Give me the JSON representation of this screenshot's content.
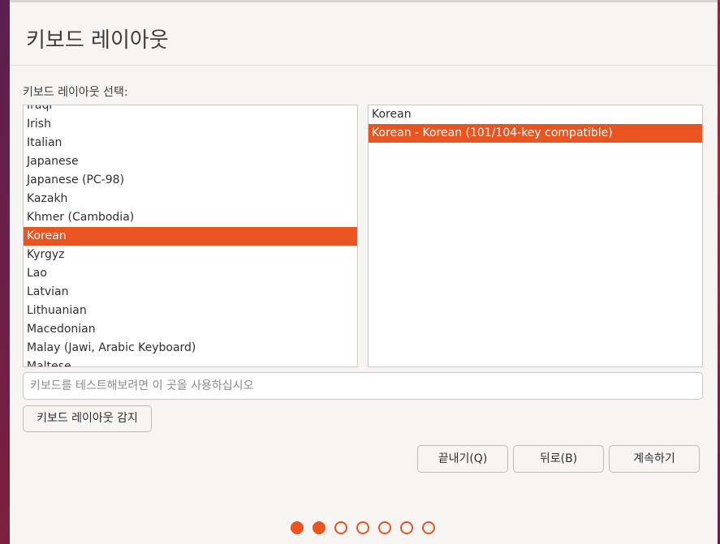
{
  "header": {
    "title": "키보드 레이아웃"
  },
  "layout_section": {
    "label": "키보드 레이아웃 선택:"
  },
  "layout_list": {
    "items": [
      {
        "label": "Iraqi",
        "selected": false
      },
      {
        "label": "Irish",
        "selected": false
      },
      {
        "label": "Italian",
        "selected": false
      },
      {
        "label": "Japanese",
        "selected": false
      },
      {
        "label": "Japanese (PC-98)",
        "selected": false
      },
      {
        "label": "Kazakh",
        "selected": false
      },
      {
        "label": "Khmer (Cambodia)",
        "selected": false
      },
      {
        "label": "Korean",
        "selected": true
      },
      {
        "label": "Kyrgyz",
        "selected": false
      },
      {
        "label": "Lao",
        "selected": false
      },
      {
        "label": "Latvian",
        "selected": false
      },
      {
        "label": "Lithuanian",
        "selected": false
      },
      {
        "label": "Macedonian",
        "selected": false
      },
      {
        "label": "Malay (Jawi, Arabic Keyboard)",
        "selected": false
      },
      {
        "label": "Maltese",
        "selected": false
      }
    ]
  },
  "variant_list": {
    "items": [
      {
        "label": "Korean",
        "selected": false
      },
      {
        "label": "Korean - Korean (101/104-key compatible)",
        "selected": true
      }
    ]
  },
  "test_field": {
    "placeholder": "키보드를 테스트해보려면 이 곳을 사용하십시오",
    "value": ""
  },
  "buttons": {
    "detect": "키보드 레이아웃 감지",
    "quit": "끝내기(Q)",
    "back": "뒤로(B)",
    "continue": "계속하기"
  },
  "progress": {
    "total_steps": 7,
    "current_step": 2
  },
  "colors": {
    "accent": "#e95420",
    "background": "#f6f5f4"
  }
}
